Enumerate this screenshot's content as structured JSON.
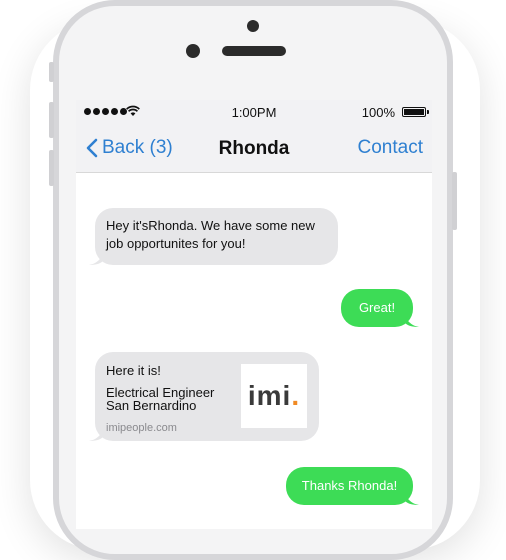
{
  "status_bar": {
    "time": "1:00PM",
    "battery": "100%",
    "signal_icon": "signal-dots-icon",
    "wifi_icon": "wifi-icon",
    "battery_icon": "battery-icon"
  },
  "nav": {
    "back_label": "Back (3)",
    "title": "Rhonda",
    "contact_label": "Contact"
  },
  "messages": {
    "m1": "Hey it'sRhonda. We have some new job opportunites for you!",
    "m2": "Great!",
    "m3_title": "Here it is!",
    "m3_line1": "Electrical Engineer",
    "m3_line2": "San Bernardino",
    "m3_link": "imipeople.com",
    "m3_logo_text": "imi",
    "m3_logo_dot": ".",
    "m4": "Thanks Rhonda!"
  },
  "colors": {
    "incoming": "#e6e6e8",
    "outgoing": "#3ddc56",
    "ios_blue": "#2f80d1",
    "logo_accent": "#f08a24"
  }
}
